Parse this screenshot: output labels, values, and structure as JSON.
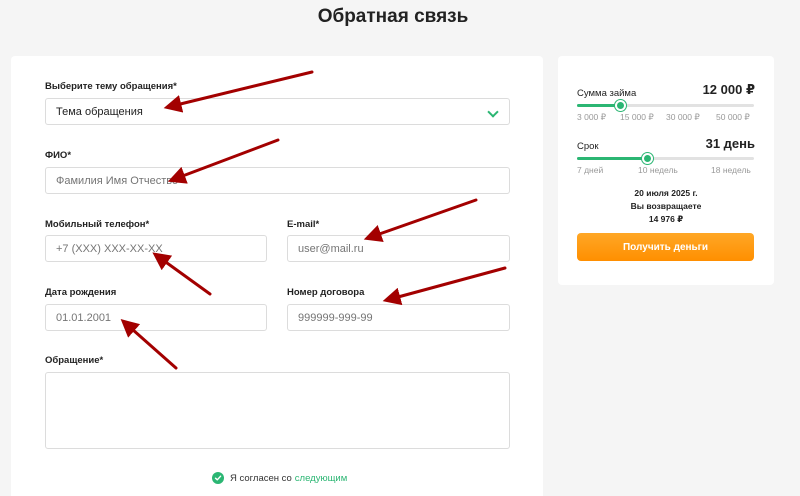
{
  "page": {
    "title": "Обратная связь"
  },
  "form": {
    "topic": {
      "label": "Выберите тему обращения*",
      "value": "Тема обращения"
    },
    "fio": {
      "label": "ФИО*",
      "placeholder": "Фамилия Имя Отчество"
    },
    "phone": {
      "label": "Мобильный телефон*",
      "placeholder": "+7 (XXX) XXX-XX-XX"
    },
    "email": {
      "label": "E-mail*",
      "placeholder": "user@mail.ru"
    },
    "birthdate": {
      "label": "Дата рождения",
      "placeholder": "01.01.2001"
    },
    "contract": {
      "label": "Номер договора",
      "placeholder": "999999-999-99"
    },
    "message": {
      "label": "Обращение*",
      "placeholder": ""
    },
    "consent": {
      "text": "Я согласен со",
      "link": "следующим",
      "checked": true
    }
  },
  "loan": {
    "amount": {
      "label": "Сумма займа",
      "value": "12 000 ₽",
      "level": 0.25,
      "ticks": [
        "3 000 ₽",
        "15 000 ₽",
        "30 000 ₽",
        "50 000 ₽"
      ]
    },
    "term": {
      "label": "Срок",
      "value": "31 день",
      "level": 0.4,
      "ticks": [
        "7 дней",
        "10 недель",
        "18 недель"
      ]
    },
    "summary": {
      "date": "20 июля 2025 г.",
      "return_label": "Вы возвращаете",
      "return_value": "14 976 ₽"
    },
    "cta_label": "Получить деньги"
  },
  "colors": {
    "accent": "#2bb673",
    "cta": "#ff9800",
    "arrow": "#a30000"
  }
}
